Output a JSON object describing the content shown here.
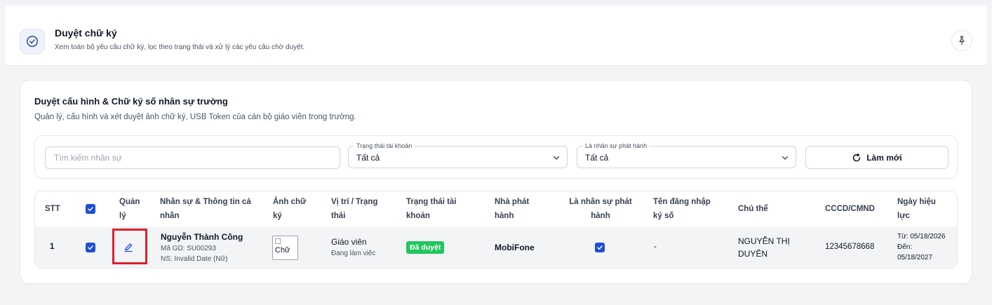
{
  "header": {
    "title": "Duyệt chữ ký",
    "subtitle": "Xem toàn bộ yêu cầu chữ ký, lọc theo trạng thái và xử lý các yêu cầu chờ duyệt."
  },
  "card": {
    "title": "Duyệt cấu hình & Chữ ký số nhân sự trường",
    "subtitle": "Quản lý, cấu hình và xét duyệt ảnh chữ ký, USB Token của cán bộ giáo viên trong trường."
  },
  "filters": {
    "search_placeholder": "Tìm kiếm nhân sự",
    "account_status": {
      "label": "Trạng thái tài khoản",
      "value": "Tất cả"
    },
    "issuer_staff": {
      "label": "Là nhân sự phát hành",
      "value": "Tất cả"
    },
    "refresh_label": "Làm mới"
  },
  "table": {
    "columns": {
      "stt": "STT",
      "manage_1": "Quản",
      "manage_2": "lý",
      "staff_1": "Nhân sự & Thông tin cá",
      "staff_2": "nhân",
      "sig_1": "Ảnh chữ",
      "sig_2": "ký",
      "pos_1": "Vị trí / Trạng",
      "pos_2": "thái",
      "acct_1": "Trạng thái tài",
      "acct_2": "khoản",
      "issuer_1": "Nhà phát",
      "issuer_2": "hành",
      "isissuer_1": "Là nhân sự phát",
      "isissuer_2": "hành",
      "login_1": "Tên đăng nhập",
      "login_2": "ký số",
      "subject": "Chủ thể",
      "cccd": "CCCD/CMND",
      "valid_1": "Ngày hiệu",
      "valid_2": "lực"
    },
    "rows": [
      {
        "stt": "1",
        "name": "Nguyễn Thành Công",
        "code": "Mã GD: SU00293",
        "dob": "NS: Invalid Date (Nữ)",
        "sig_alt": "Chữ",
        "position": "Giáo viên",
        "work_status": "Đang làm việc",
        "account_status": "Đã duyệt",
        "issuer": "MobiFone",
        "login": "-",
        "subject_1": "NGUYỄN THỊ",
        "subject_2": "DUYÊN",
        "cccd": "12345678668",
        "valid_from": "Từ: 05/18/2026",
        "valid_to_label": "Đến:",
        "valid_to": "05/18/2027"
      }
    ]
  },
  "colors": {
    "accent": "#1d4ed8",
    "success": "#22c55e",
    "highlight": "#e11d2e"
  },
  "icons": {
    "header": "check-circle-icon",
    "pin": "pin-icon",
    "chevron": "chevron-down-icon",
    "refresh": "refresh-icon",
    "edit": "pencil-icon",
    "checkbox": "check-icon"
  }
}
